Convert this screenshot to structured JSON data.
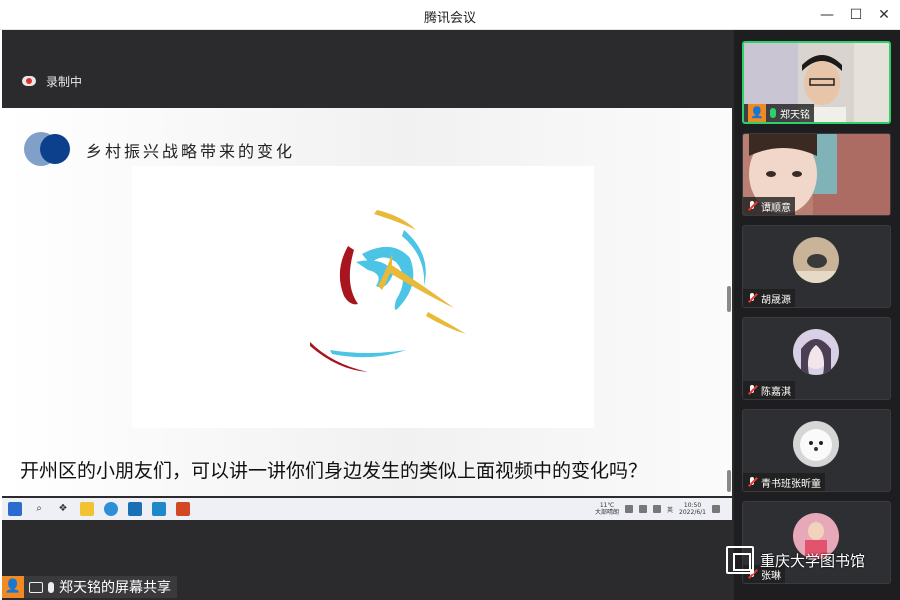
{
  "window": {
    "title": "腾讯会议",
    "minimize": "—",
    "maximize": "☐",
    "close": "✕"
  },
  "recording": {
    "label": "录制中"
  },
  "slide": {
    "heading": "乡村振兴战略带来的变化",
    "caption": "开州区的小朋友们，可以讲一讲你们身边发生的类似上面视频中的变化吗？"
  },
  "taskbar": {
    "icons": [
      "windows-start",
      "search",
      "task-view",
      "file-explorer",
      "browser",
      "mail",
      "store",
      "powerpoint"
    ],
    "tray_temp": "11℃",
    "tray_weather": "大部晴朗",
    "ime": "英",
    "time": "10:50",
    "date": "2022/6/1"
  },
  "share": {
    "label": "郑天铭的屏幕共享"
  },
  "participants": [
    {
      "name": "郑天铭",
      "muted": false,
      "active": true
    },
    {
      "name": "谭顺意",
      "muted": true,
      "active": false
    },
    {
      "name": "胡晟源",
      "muted": true,
      "active": false
    },
    {
      "name": "陈嘉淇",
      "muted": true,
      "active": false
    },
    {
      "name": "青书班张昕童",
      "muted": true,
      "active": false
    },
    {
      "name": "张琳",
      "muted": true,
      "active": false
    }
  ],
  "watermark": {
    "text": "重庆大学图书馆"
  },
  "colors": {
    "accent_green": "#2ed06a",
    "orange": "#f08a24",
    "dark_bg": "#2b2b2d",
    "red_muted": "#e53935"
  }
}
